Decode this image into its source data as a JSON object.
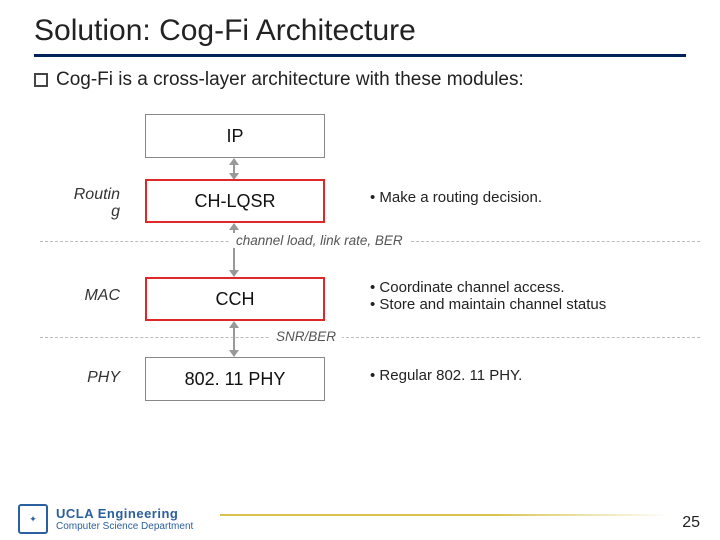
{
  "title": "Solution: Cog-Fi Architecture",
  "bullet": "Cog-Fi is a cross-layer architecture with these modules:",
  "layers": {
    "ip": "IP",
    "chlqsr": "CH-LQSR",
    "cch": "CCH",
    "phy": "802. 11 PHY"
  },
  "labels": {
    "routin_line1": "Routin",
    "routin_line2": "g",
    "mac": "MAC",
    "phy": "PHY"
  },
  "dividers": {
    "d1": "channel load, link rate, BER",
    "d2": "SNR/BER"
  },
  "desc": {
    "chlqsr": [
      "Make a routing decision."
    ],
    "cch": [
      "Coordinate channel access.",
      "Store and maintain channel status"
    ],
    "phy": [
      "Regular 802. 11 PHY."
    ]
  },
  "footer": {
    "logo_line1": "UCLA Engineering",
    "logo_line2": "Computer Science Department",
    "page": "25"
  }
}
